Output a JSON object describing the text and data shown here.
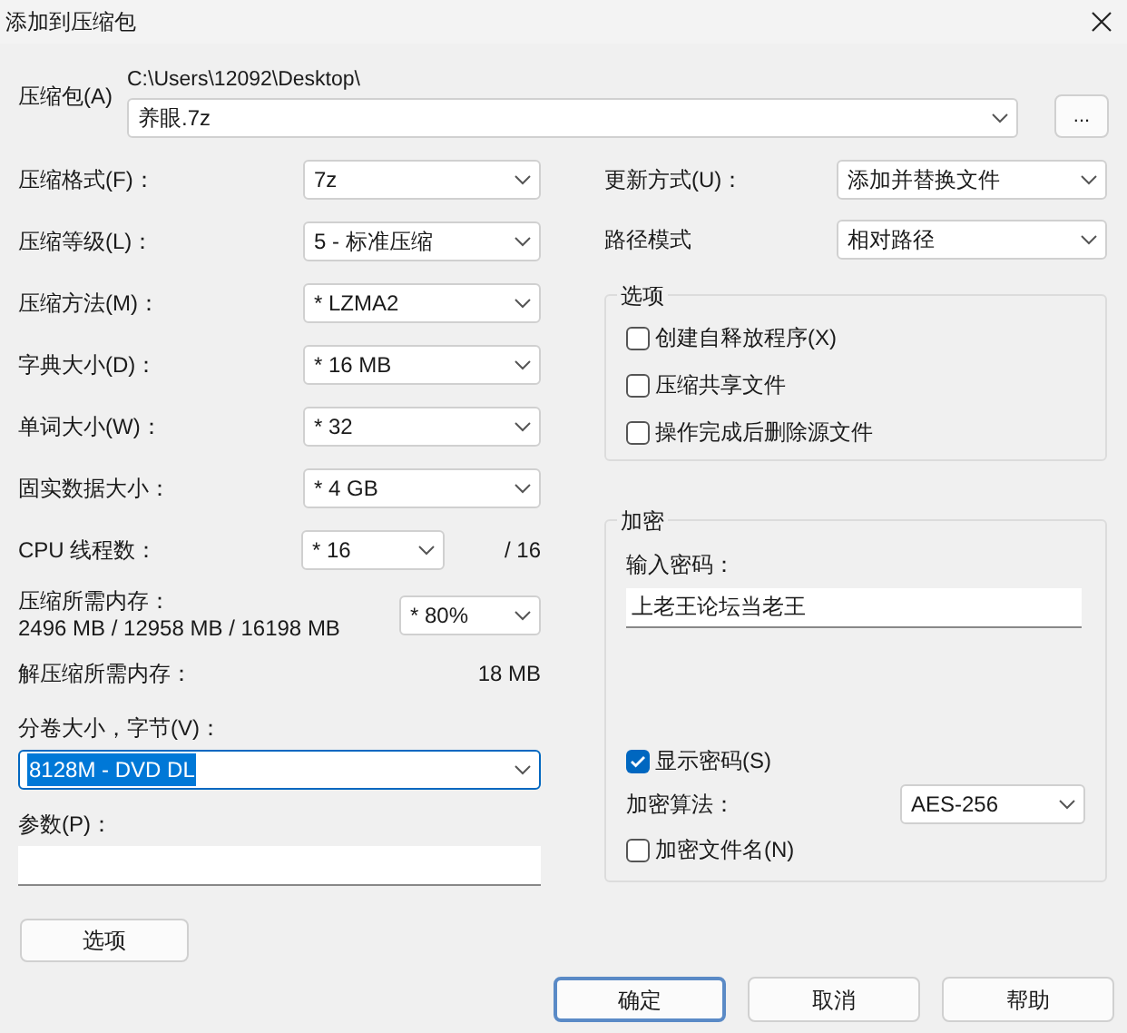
{
  "window": {
    "title": "添加到压缩包"
  },
  "archive": {
    "label": "压缩包(A)",
    "path": "C:\\Users\\12092\\Desktop\\",
    "value": "养眼.7z",
    "browse": "..."
  },
  "settings": [
    {
      "label": "压缩格式(F)：",
      "value": "7z"
    },
    {
      "label": "压缩等级(L)：",
      "value": "5 - 标准压缩"
    },
    {
      "label": "压缩方法(M)：",
      "value": "* LZMA2"
    },
    {
      "label": "字典大小(D)：",
      "value": "* 16 MB"
    },
    {
      "label": "单词大小(W)：",
      "value": "* 32"
    },
    {
      "label": "固实数据大小：",
      "value": "* 4 GB"
    }
  ],
  "cpu": {
    "label": "CPU 线程数：",
    "value": "* 16",
    "max": "/ 16"
  },
  "memory": {
    "label": "压缩所需内存：",
    "detail": "2496 MB / 12958 MB / 16198 MB",
    "value": "* 80%"
  },
  "decompress_memory": {
    "label": "解压缩所需内存：",
    "value": "18 MB"
  },
  "volume": {
    "label": "分卷大小，字节(V)：",
    "value": "8128M - DVD DL",
    "text_selected": true
  },
  "parameters": {
    "label": "参数(P)："
  },
  "options_button": "选项",
  "update": {
    "label": "更新方式(U)：",
    "value": "添加并替换文件"
  },
  "path_mode": {
    "label": "路径模式",
    "value": "相对路径"
  },
  "options_group": {
    "title": "选项",
    "items": [
      {
        "label": "创建自释放程序(X)",
        "checked": false
      },
      {
        "label": "压缩共享文件",
        "checked": false
      },
      {
        "label": "操作完成后删除源文件",
        "checked": false
      }
    ]
  },
  "encryption": {
    "title": "加密",
    "password_label": "输入密码：",
    "password": "上老王论坛当老王",
    "show_password": {
      "label": "显示密码(S)",
      "checked": true
    },
    "method_label": "加密算法：",
    "method": "AES-256",
    "encrypt_names": {
      "label": "加密文件名(N)",
      "checked": false
    }
  },
  "buttons": [
    {
      "label": "确定",
      "default": true
    },
    {
      "label": "取消",
      "default": false
    },
    {
      "label": "帮助",
      "default": false
    }
  ]
}
